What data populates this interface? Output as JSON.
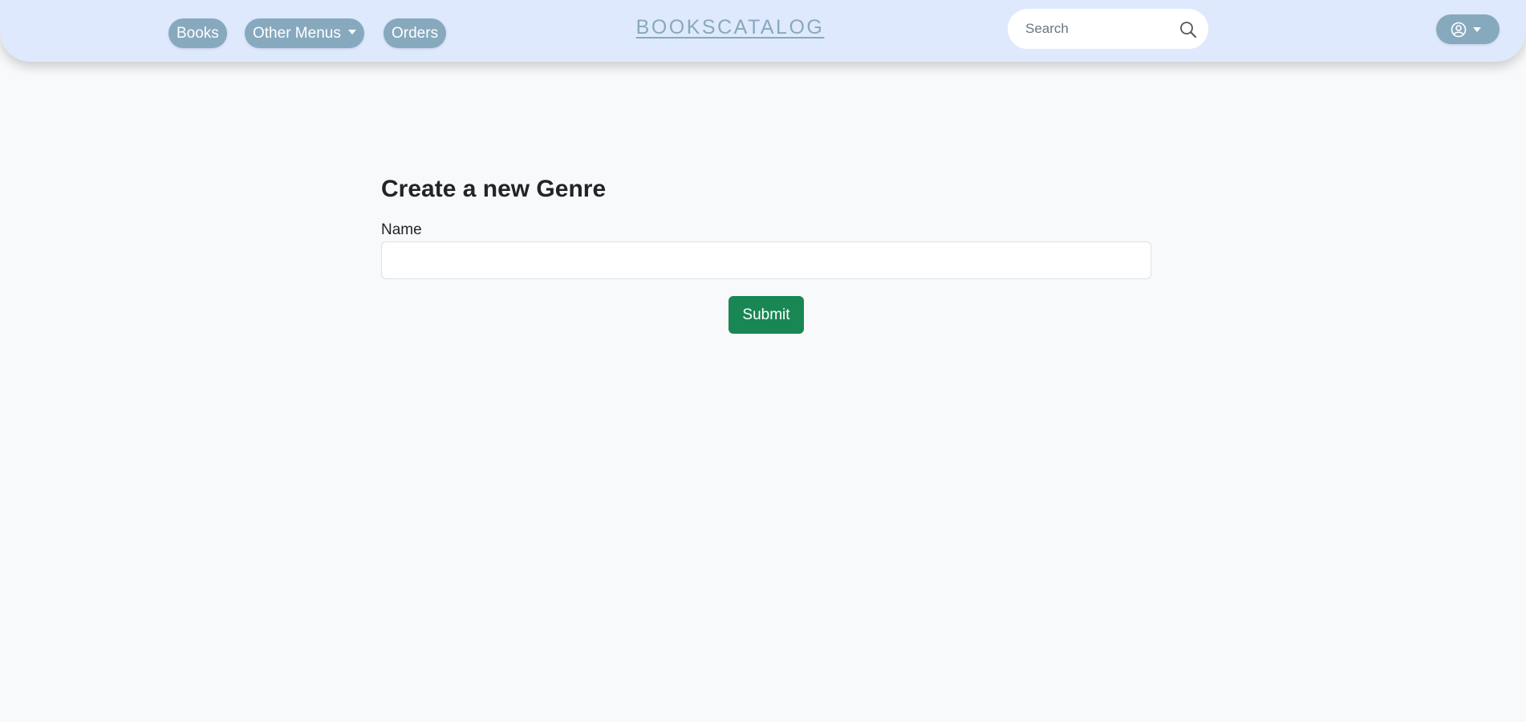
{
  "navbar": {
    "links": [
      {
        "label": "Books"
      },
      {
        "label": "Other Menus",
        "dropdown": true
      },
      {
        "label": "Orders"
      }
    ],
    "brand": "BOOKSCATALOG",
    "search": {
      "placeholder": "Search",
      "value": "",
      "icon": "search-icon"
    },
    "user_menu": {
      "icon": "user-circle-icon",
      "dropdown": true
    }
  },
  "form": {
    "title": "Create a new Genre",
    "fields": [
      {
        "label": "Name",
        "value": "",
        "placeholder": ""
      }
    ],
    "submit_label": "Submit"
  },
  "colors": {
    "navbar_bg": "#dfe9fd",
    "pill_bg": "#87a9be",
    "brand": "#87a9be",
    "submit_bg": "#198754",
    "page_bg": "#f8f9fa"
  }
}
